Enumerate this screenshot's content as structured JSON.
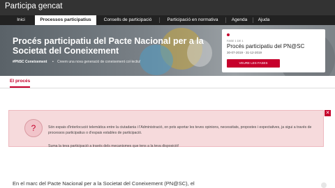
{
  "app": {
    "brand": "Participa gencat"
  },
  "nav": {
    "items": [
      "Inici",
      "Processos participatius",
      "Consells de participació",
      "Participació en normativa",
      "Agenda",
      "Ajuda"
    ],
    "active": "Processos participatius"
  },
  "hero": {
    "title": "Procés participatiu del Pacte Nacional per a la Societat del Coneixement",
    "hashtag": "#PNSC Coneixement",
    "separator": "•",
    "subtitle": "Creem una nova generació de coneixement col·lectiu!"
  },
  "phase_card": {
    "label": "FASE 1 DE 1",
    "title": "Procés participatiu del PN@SC",
    "dates": "30-07-2019 - 31-12-2019",
    "button": "VEURE LES FASES"
  },
  "tabs": {
    "process": "El procés"
  },
  "callout": {
    "icon": "question-icon",
    "close_icon": "close-icon",
    "paragraph1": "Són espais d'interlocució telemàtica entre la ciutadania i l'Administració, on pots aportar les teves opinions, necessitats, propostes i expectatives, ja sigui a través de processos participatius o d'espais estables de participació.",
    "paragraph2": "Suma la teva participació a través dels mecanismes que tens a la teva disposició!"
  },
  "body": {
    "intro": "En el marc del Pacte Nacional per a la Societat del Coneixement (PN@SC), el"
  },
  "colors": {
    "accent": "#c6002b",
    "topbar": "#333333",
    "navbar": "#222222",
    "callout_bg": "#f6dadc"
  }
}
